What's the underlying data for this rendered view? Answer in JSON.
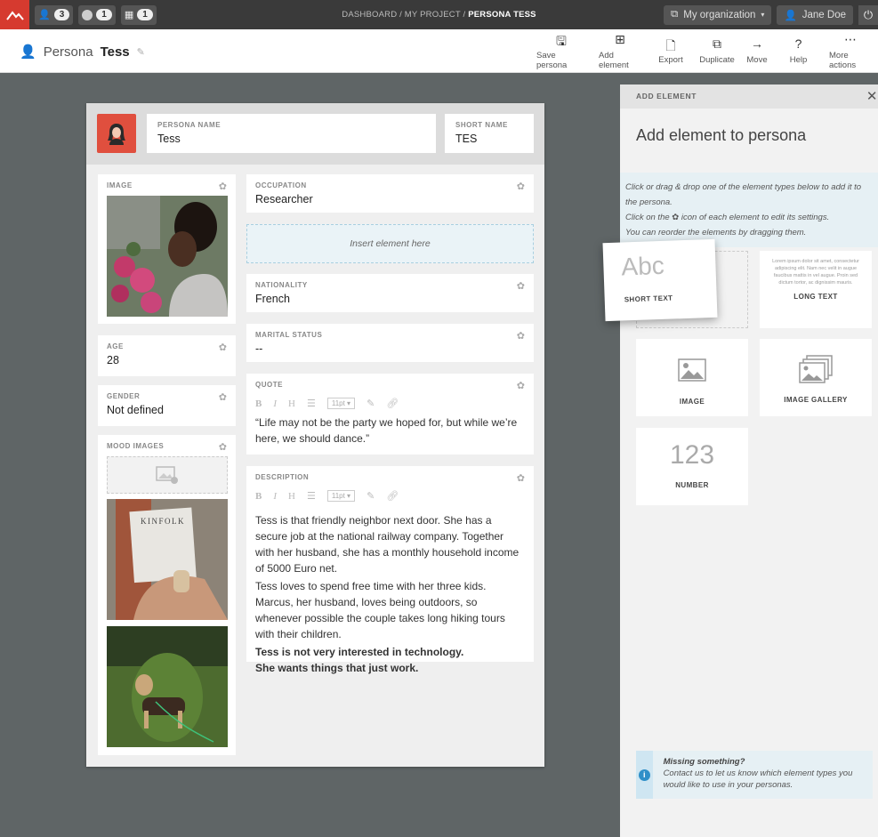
{
  "topbar": {
    "counts": [
      "3",
      "1",
      "1"
    ],
    "breadcrumb_prefix": "DASHBOARD / MY PROJECT / ",
    "breadcrumb_current": "PERSONA TESS",
    "org_label": "My organization",
    "user_label": "Jane Doe"
  },
  "header": {
    "title_prefix": "Persona",
    "title_name": "Tess",
    "actions": [
      "Save persona",
      "Add element",
      "Export",
      "Duplicate",
      "Move",
      "Help",
      "More actions"
    ]
  },
  "persona": {
    "name_label": "PERSONA NAME",
    "name_value": "Tess",
    "short_label": "SHORT NAME",
    "short_value": "TES",
    "image_label": "IMAGE",
    "age_label": "AGE",
    "age_value": "28",
    "gender_label": "GENDER",
    "gender_value": "Not defined",
    "mood_label": "MOOD IMAGES",
    "mood_text": "KINFOLK",
    "occupation_label": "OCCUPATION",
    "occupation_value": "Researcher",
    "insert_text": "Insert element here",
    "nationality_label": "NATIONALITY",
    "nationality_value": "French",
    "marital_label": "MARITAL STATUS",
    "marital_value": "--",
    "quote_label": "QUOTE",
    "quote_value": "“Life may not be the party we hoped for, but while we’re here, we should dance.”",
    "font_size": "11pt",
    "description_label": "DESCRIPTION",
    "description_p1": "Tess is that friendly neighbor next door. She has a secure job at the national railway company. Together with her husband, she has a monthly household income of 5000 Euro net.",
    "description_p2": "Tess loves to spend free time with her three kids. Marcus, her husband, loves being outdoors, so whenever possible the couple takes long hiking tours with their children.",
    "description_bold1": "Tess is not very interested in technology.",
    "description_bold2": "She wants things that just work."
  },
  "panel": {
    "header": "ADD ELEMENT",
    "title": "Add element to persona",
    "hint1": "Click or drag & drop one of the element types below to add it to the persona.",
    "hint2a": "Click on the",
    "hint2b": "icon of each element to edit its settings.",
    "hint3": "You can reorder the elements by dragging them.",
    "short_text_sample": "Abc",
    "short_text_label": "SHORT TEXT",
    "long_text_sample": "Lorem ipsum dolor sit amet, consectetur adipiscing elit. Nam nec velit in augue faucibus mattis in vel augue. Proin sed dictum tortor, ac dignissim mauris.",
    "long_text_label": "LONG TEXT",
    "image_label": "IMAGE",
    "gallery_label": "IMAGE GALLERY",
    "number_sample": "123",
    "number_label": "NUMBER",
    "missing_title": "Missing something?",
    "missing_body": "Contact us to let us know which element types you would like to use in your personas."
  },
  "colors": {
    "accent": "#d63a2f",
    "avatar_bg": "#e04f3e",
    "hint_bg": "#e6f0f4"
  }
}
